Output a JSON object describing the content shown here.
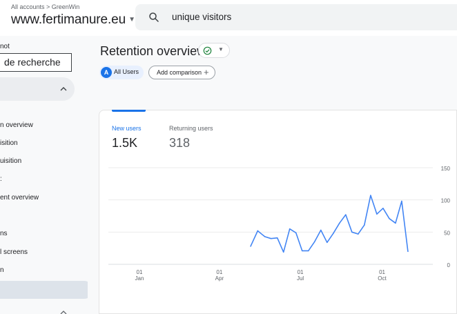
{
  "header": {
    "breadcrumb": "All accounts > GreenWin",
    "property_name": "www.fertimanure.eu",
    "search_query": "unique visitors"
  },
  "sidebar": {
    "top_label": "not",
    "search_text": "de recherche",
    "items": [
      {
        "label": "n overview"
      },
      {
        "label": "isition"
      },
      {
        "label": "uisition"
      },
      {
        "label": ":"
      },
      {
        "label": "ent overview"
      },
      {
        "label": ""
      },
      {
        "label": "ns"
      },
      {
        "label": "l screens"
      },
      {
        "label": "n"
      }
    ]
  },
  "main": {
    "title": "Retention overview",
    "comparison": {
      "avatar_letter": "A",
      "all_users_label": "All Users",
      "add_comparison_label": "Add comparison"
    },
    "metrics": [
      {
        "label": "New users",
        "value": "1.5K",
        "active": true
      },
      {
        "label": "Returning users",
        "value": "318",
        "active": false
      }
    ]
  },
  "colors": {
    "accent": "#1a73e8",
    "success": "#188038",
    "chip_bg": "#e8f0fe",
    "line": "#4285f4"
  },
  "chart_data": {
    "type": "line",
    "xlabel": "",
    "ylabel": "",
    "ylim": [
      0,
      150
    ],
    "yticks": [
      0,
      50,
      100,
      150
    ],
    "xticks": [
      {
        "day": "01",
        "month": "Jan"
      },
      {
        "day": "01",
        "month": "Apr"
      },
      {
        "day": "01",
        "month": "Jul"
      },
      {
        "day": "01",
        "month": "Oct"
      }
    ],
    "grid": true,
    "x_start": "2023-01-01",
    "series": [
      {
        "values": [
          {
            "x": "2023-06-10",
            "y": 28
          },
          {
            "x": "2023-06-18",
            "y": 52
          },
          {
            "x": "2023-06-26",
            "y": 43
          },
          {
            "x": "2023-07-03",
            "y": 40
          },
          {
            "x": "2023-07-10",
            "y": 41
          },
          {
            "x": "2023-07-17",
            "y": 19
          },
          {
            "x": "2023-07-24",
            "y": 55
          },
          {
            "x": "2023-07-31",
            "y": 49
          },
          {
            "x": "2023-08-07",
            "y": 21
          },
          {
            "x": "2023-08-14",
            "y": 21
          },
          {
            "x": "2023-08-21",
            "y": 35
          },
          {
            "x": "2023-08-28",
            "y": 53
          },
          {
            "x": "2023-09-04",
            "y": 34
          },
          {
            "x": "2023-09-11",
            "y": 48
          },
          {
            "x": "2023-09-18",
            "y": 64
          },
          {
            "x": "2023-09-25",
            "y": 77
          },
          {
            "x": "2023-10-02",
            "y": 50
          },
          {
            "x": "2023-10-09",
            "y": 47
          },
          {
            "x": "2023-10-16",
            "y": 61
          },
          {
            "x": "2023-10-23",
            "y": 107
          },
          {
            "x": "2023-10-30",
            "y": 78
          },
          {
            "x": "2023-11-06",
            "y": 87
          },
          {
            "x": "2023-11-13",
            "y": 71
          },
          {
            "x": "2023-11-20",
            "y": 64
          },
          {
            "x": "2023-11-27",
            "y": 98
          },
          {
            "x": "2023-12-04",
            "y": 20
          }
        ]
      }
    ]
  }
}
